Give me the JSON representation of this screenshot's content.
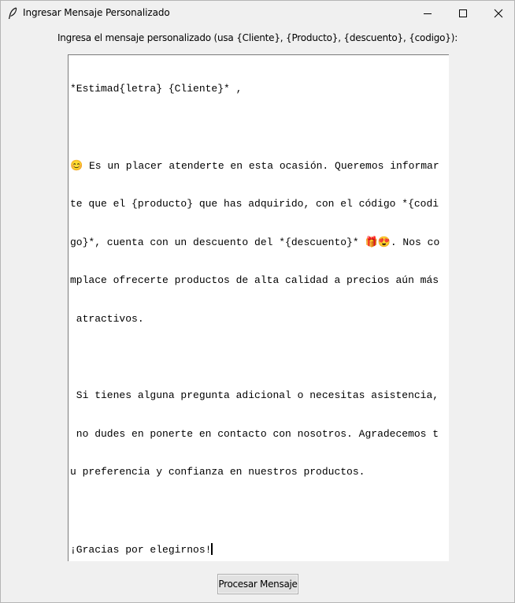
{
  "window": {
    "title": "Ingresar Mensaje Personalizado",
    "app_icon": "feather-icon",
    "controls": {
      "minimize": "minimize-icon",
      "maximize": "maximize-icon",
      "close": "close-icon"
    }
  },
  "prompt": {
    "label": "Ingresa el mensaje personalizado (usa {Cliente}, {Producto}, {descuento}, {codigo}):"
  },
  "editor": {
    "lines": [
      "*Estimad{letra} {Cliente}* ,",
      "",
      "😊 Es un placer atenderte en esta ocasión. Queremos informar",
      "te que el {producto} que has adquirido, con el código *{codi",
      "go}*, cuenta con un descuento del *{descuento}* 🎁😍. Nos co",
      "mplace ofrecerte productos de alta calidad a precios aún más",
      " atractivos.",
      "",
      " Si tienes alguna pregunta adicional o necesitas asistencia,",
      " no dudes en ponerte en contacto con nosotros. Agradecemos t",
      "u preferencia y confianza en nuestros productos.",
      "",
      "¡Gracias por elegirnos!"
    ]
  },
  "actions": {
    "process_label": "Procesar Mensaje"
  }
}
